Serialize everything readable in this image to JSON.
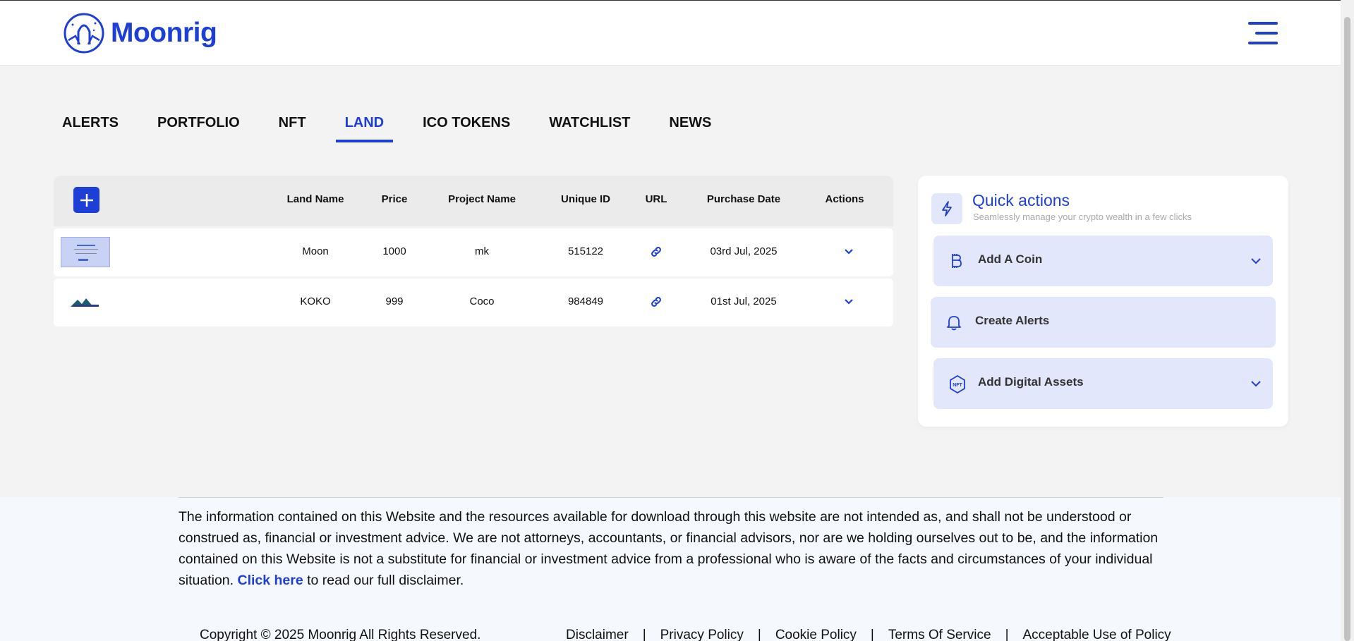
{
  "brand": {
    "name": "Moonrig",
    "color": "#1e3fd6"
  },
  "tabs": [
    "ALERTS",
    "PORTFOLIO",
    "NFT",
    "LAND",
    "ICO TOKENS",
    "WATCHLIST",
    "NEWS"
  ],
  "active_tab": "LAND",
  "table": {
    "headers": {
      "land_name": "Land Name",
      "price": "Price",
      "project_name": "Project Name",
      "unique_id": "Unique ID",
      "url": "URL",
      "purchase_date": "Purchase Date",
      "actions": "Actions"
    },
    "rows": [
      {
        "land_name": "Moon",
        "price": "1000",
        "project_name": "mk",
        "unique_id": "515122",
        "purchase_date": "03rd Jul, 2025",
        "url_icon": "link-icon",
        "action_icon": "chevron-down-icon"
      },
      {
        "land_name": "KOKO",
        "price": "999",
        "project_name": "Coco",
        "unique_id": "984849",
        "purchase_date": "01st Jul, 2025",
        "url_icon": "link-icon",
        "action_icon": "chevron-down-icon"
      }
    ]
  },
  "quick_actions": {
    "title": "Quick actions",
    "subtitle": "Seamlessly manage your crypto wealth in a few clicks",
    "items": [
      {
        "label": "Add A Coin",
        "icon": "bitcoin-icon"
      },
      {
        "label": "Create Alerts",
        "icon": "bell-icon"
      },
      {
        "label": "Add Digital Assets",
        "icon": "nft-icon"
      }
    ]
  },
  "footer": {
    "disclaimer_text": "The information contained on this Website and the resources available for download through this website are not intended as, and shall not be understood or construed as, financial or investment advice. We are not attorneys, accountants, or financial advisors, nor are we holding ourselves out to be, and the information contained on this Website is not a substitute for financial or investment advice from a professional who is aware of the facts and circumstances of your individual situation.",
    "click_here": "Click here",
    "disclaimer_suffix": "to read our full disclaimer.",
    "copyright": "Copyright © 2025 Moonrig All Rights Reserved.",
    "links": [
      "Disclaimer",
      "Privacy Policy",
      "Cookie Policy",
      "Terms Of Service",
      "Acceptable Use of Policy"
    ]
  }
}
